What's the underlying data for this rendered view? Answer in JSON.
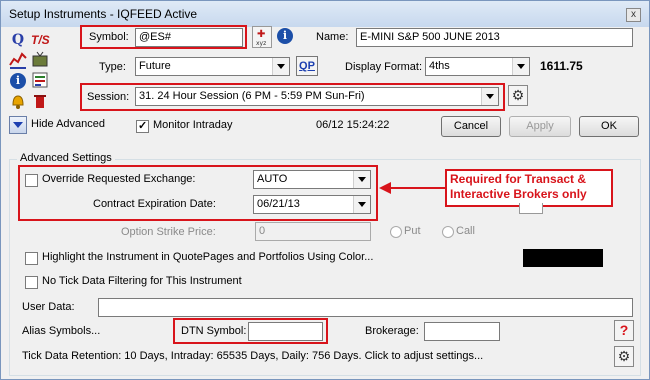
{
  "window": {
    "title": "Setup Instruments - IQFEED Active",
    "close": "x"
  },
  "symbol": {
    "label": "Symbol:",
    "value": "@ES#"
  },
  "name": {
    "label": "Name:",
    "value": "E-MINI S&P 500 JUNE 2013"
  },
  "type": {
    "label": "Type:",
    "value": "Future"
  },
  "qp": {
    "label": "QP"
  },
  "display_format": {
    "label": "Display Format:",
    "value": "4ths"
  },
  "price": "1611.75",
  "session": {
    "label": "Session:",
    "value": "31. 24 Hour Session (6 PM - 5:59 PM Sun-Fri)"
  },
  "hide_advanced": {
    "label": "Hide Advanced"
  },
  "monitor_intraday": {
    "label": "Monitor Intraday",
    "checked": true
  },
  "timestamp": "06/12 15:24:22",
  "buttons": {
    "cancel": "Cancel",
    "apply": "Apply",
    "ok": "OK"
  },
  "advanced": {
    "group_label": "Advanced Settings",
    "override_exchange": {
      "label": "Override Requested Exchange:",
      "value": "AUTO",
      "checked": false
    },
    "contract_expiration": {
      "label": "Contract Expiration Date:",
      "value": "06/21/13"
    },
    "option_strike": {
      "label": "Option Strike Price:",
      "value": "0"
    },
    "put": "Put",
    "call": "Call",
    "callout": "Required for Transact & Interactive Brokers only",
    "highlight": {
      "label": "Highlight the Instrument in QuotePages and Portfolios Using Color..."
    },
    "no_tick": {
      "label": "No Tick Data Filtering for This Instrument"
    },
    "user_data": {
      "label": "User Data:",
      "value": ""
    },
    "alias_symbols": "Alias Symbols...",
    "dtn_symbol": {
      "label": "DTN Symbol:",
      "value": ""
    },
    "brokerage": {
      "label": "Brokerage:",
      "value": ""
    },
    "tick_retention": "Tick Data Retention: 10 Days, Intraday: 65535 Days, Daily: 756 Days. Click to adjust settings..."
  },
  "colors": {
    "highlight_swatch": "#000000",
    "annotation": "#d8141b",
    "info": "#1c4fa8"
  },
  "icons": [
    "quote-icon",
    "time-sales-icon",
    "chart-icon",
    "tv-icon",
    "info-icon",
    "quotepage-icon",
    "alert-icon",
    "delete-icon",
    "symbol-lookup-icon",
    "settings-icon",
    "help-icon"
  ]
}
